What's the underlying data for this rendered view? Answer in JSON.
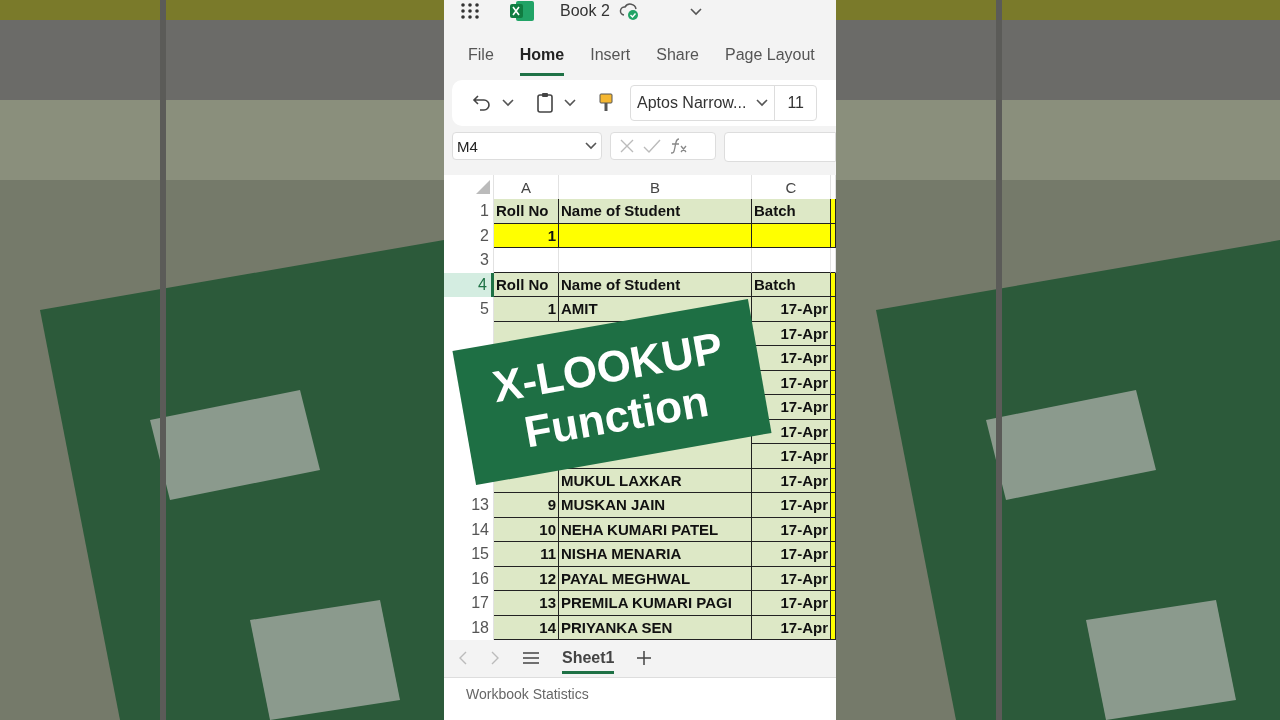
{
  "app": {
    "title": "Book 2"
  },
  "ribbon_tabs": [
    {
      "label": "File",
      "selected": false
    },
    {
      "label": "Home",
      "selected": true
    },
    {
      "label": "Insert",
      "selected": false
    },
    {
      "label": "Share",
      "selected": false
    },
    {
      "label": "Page Layout",
      "selected": false
    }
  ],
  "toolbar": {
    "font": "Aptos Narrow...",
    "font_size": "11"
  },
  "formula_bar": {
    "name_box": "M4"
  },
  "columns": [
    "A",
    "B",
    "C"
  ],
  "rows": [
    {
      "number": "1",
      "kind": "header",
      "selected": false,
      "a": "Roll No",
      "b": "Name of Student",
      "c": "Batch"
    },
    {
      "number": "2",
      "kind": "highlight",
      "selected": false,
      "a": "1"
    },
    {
      "number": "3",
      "kind": "blank",
      "selected": false
    },
    {
      "number": "4",
      "kind": "header",
      "selected": true,
      "a": "Roll No",
      "b": "Name of Student",
      "c": "Batch"
    },
    {
      "number": "5",
      "kind": "data",
      "selected": false,
      "a": "1",
      "b": "AMIT",
      "c": "17-Apr"
    },
    {
      "kind": "data",
      "selected": false,
      "c": "17-Apr"
    },
    {
      "kind": "data",
      "selected": false,
      "c": "17-Apr"
    },
    {
      "kind": "data",
      "selected": false,
      "c": "17-Apr"
    },
    {
      "kind": "data",
      "selected": false,
      "c": "17-Apr"
    },
    {
      "kind": "data",
      "selected": false,
      "c": "17-Apr"
    },
    {
      "kind": "data",
      "selected": false,
      "c": "17-Apr"
    },
    {
      "kind": "data",
      "selected": false,
      "b": "MUKUL LAXKAR",
      "c": "17-Apr"
    },
    {
      "number": "13",
      "kind": "data",
      "selected": false,
      "a": "9",
      "b": "MUSKAN JAIN",
      "c": "17-Apr"
    },
    {
      "number": "14",
      "kind": "data",
      "selected": false,
      "a": "10",
      "b": "NEHA KUMARI PATEL",
      "c": "17-Apr"
    },
    {
      "number": "15",
      "kind": "data",
      "selected": false,
      "a": "11",
      "b": "NISHA MENARIA",
      "c": "17-Apr"
    },
    {
      "number": "16",
      "kind": "data",
      "selected": false,
      "a": "12",
      "b": "PAYAL MEGHWAL",
      "c": "17-Apr"
    },
    {
      "number": "17",
      "kind": "data",
      "selected": false,
      "a": "13",
      "b": "PREMILA KUMARI PAGI",
      "c": "17-Apr"
    },
    {
      "number": "18",
      "kind": "data",
      "selected": false,
      "a": "14",
      "b": "PRIYANKA SEN",
      "c": "17-Apr"
    }
  ],
  "banner": {
    "lines": [
      "X-LOOKUP",
      "Function"
    ]
  },
  "sheet_tabs": [
    {
      "label": "Sheet1",
      "selected": true
    }
  ],
  "status_bar": {
    "text": "Workbook Statistics"
  }
}
